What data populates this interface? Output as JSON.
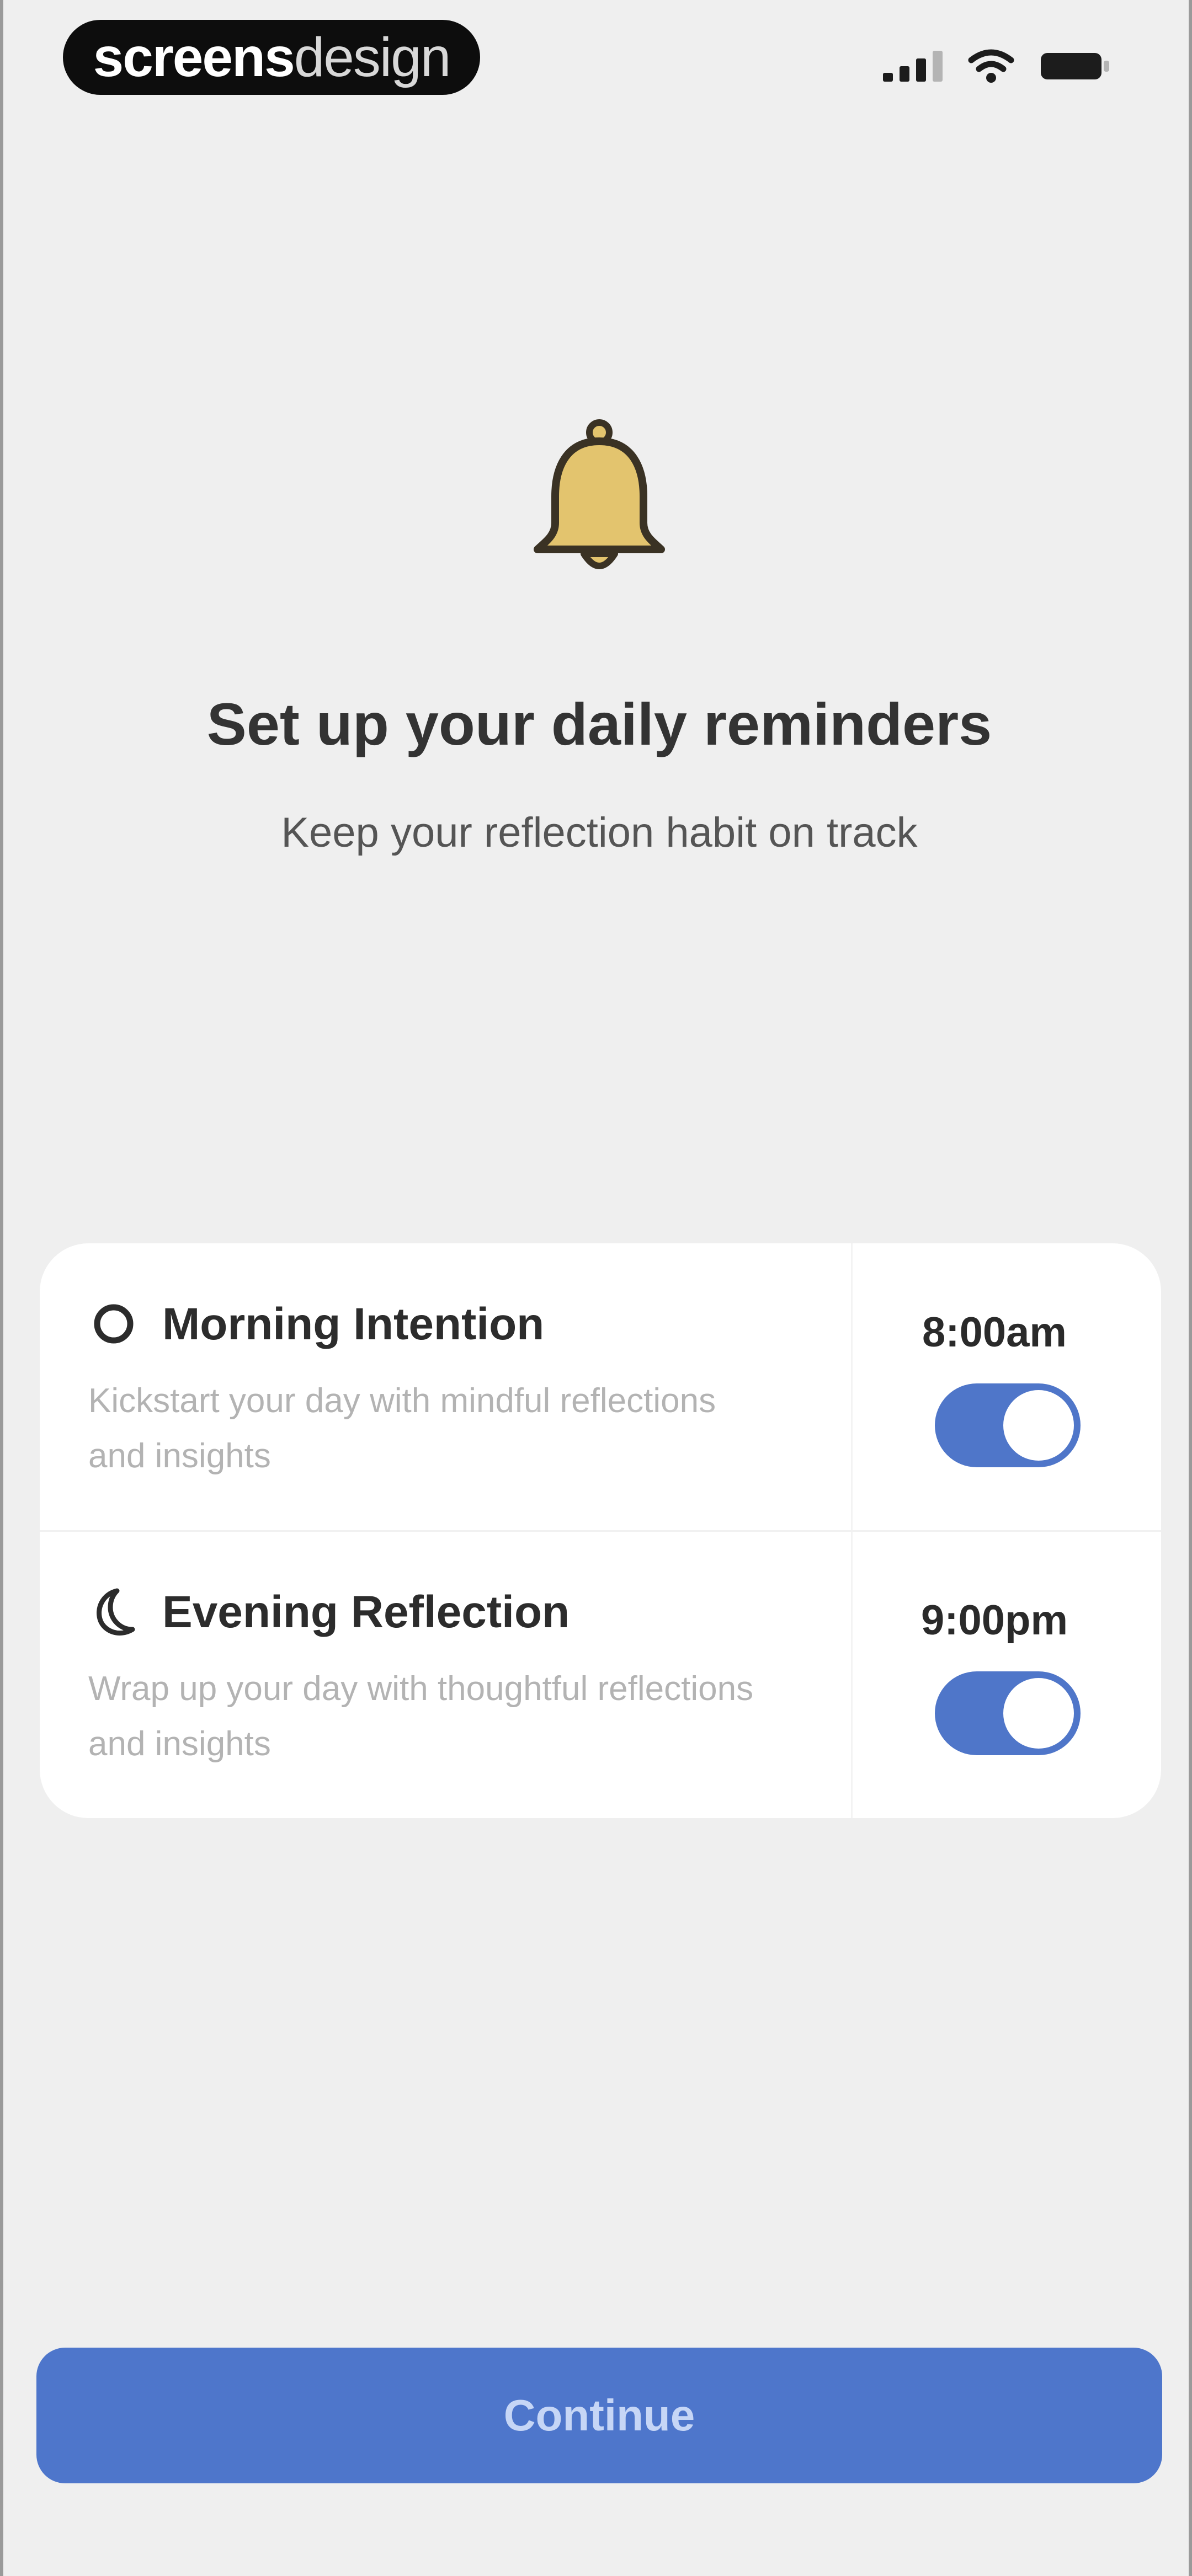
{
  "status_bar": {
    "brand_bold": "screens",
    "brand_light": "design",
    "icons": [
      "cellular-signal-icon",
      "wifi-icon",
      "battery-icon"
    ]
  },
  "hero": {
    "icon": "bell-icon",
    "title": "Set up your daily reminders",
    "subtitle": "Keep your reflection habit on track"
  },
  "reminders": [
    {
      "icon": "sun-icon",
      "title": "Morning Intention",
      "description": "Kickstart your day with mindful reflections and insights",
      "time": "8:00am",
      "enabled": true
    },
    {
      "icon": "moon-icon",
      "title": "Evening Reflection",
      "description": "Wrap up your day with thoughtful reflections and insights",
      "time": "9:00pm",
      "enabled": true
    }
  ],
  "footer": {
    "continue_label": "Continue"
  },
  "colors": {
    "accent": "#4e76cb",
    "background": "#efefef",
    "bell": "#e3c46e"
  }
}
